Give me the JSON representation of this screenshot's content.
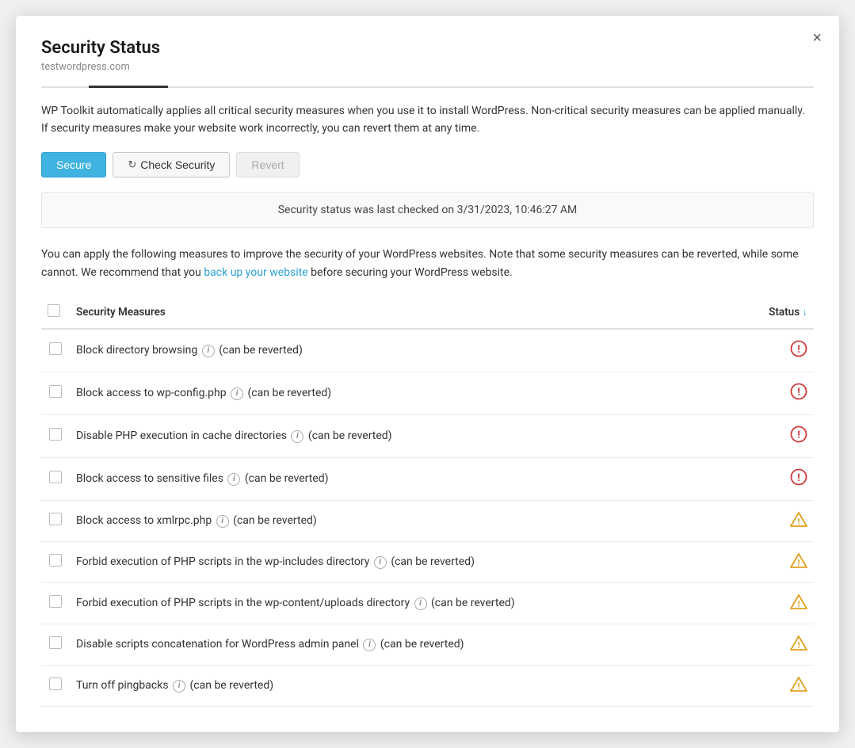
{
  "dialog": {
    "title": "Security Status",
    "subtitle": "testwordpress.com",
    "close_label": "×"
  },
  "description": "WP Toolkit automatically applies all critical security measures when you use it to install WordPress. Non-critical security measures can be applied manually. If security measures make your website work incorrectly, you can revert them at any time.",
  "buttons": {
    "secure": "Secure",
    "check_security": "Check Security",
    "revert": "Revert"
  },
  "status_bar": {
    "text": "Security status was last checked on 3/31/2023, 10:46:27 AM"
  },
  "apply_description_part1": "You can apply the following measures to improve the security of your WordPress websites. Note that some security measures can be reverted, while some cannot. We recommend that you ",
  "apply_description_link": "back up your website",
  "apply_description_part2": " before securing your WordPress website.",
  "table": {
    "col_measures": "Security Measures",
    "col_status": "Status",
    "rows": [
      {
        "label": "Block directory browsing",
        "note": "(can be reverted)",
        "status": "error"
      },
      {
        "label": "Block access to wp-config.php",
        "note": "(can be reverted)",
        "status": "error"
      },
      {
        "label": "Disable PHP execution in cache directories",
        "note": "(can be reverted)",
        "status": "error"
      },
      {
        "label": "Block access to sensitive files",
        "note": "(can be reverted)",
        "status": "error"
      },
      {
        "label": "Block access to xmlrpc.php",
        "note": "(can be reverted)",
        "status": "warn"
      },
      {
        "label": "Forbid execution of PHP scripts in the wp-includes directory",
        "note": "(can be reverted)",
        "status": "warn"
      },
      {
        "label": "Forbid execution of PHP scripts in the wp-content/uploads directory",
        "note": "(can be reverted)",
        "status": "warn"
      },
      {
        "label": "Disable scripts concatenation for WordPress admin panel",
        "note": "(can be reverted)",
        "status": "warn"
      },
      {
        "label": "Turn off pingbacks",
        "note": "(can be reverted)",
        "status": "warn_partial"
      }
    ]
  }
}
